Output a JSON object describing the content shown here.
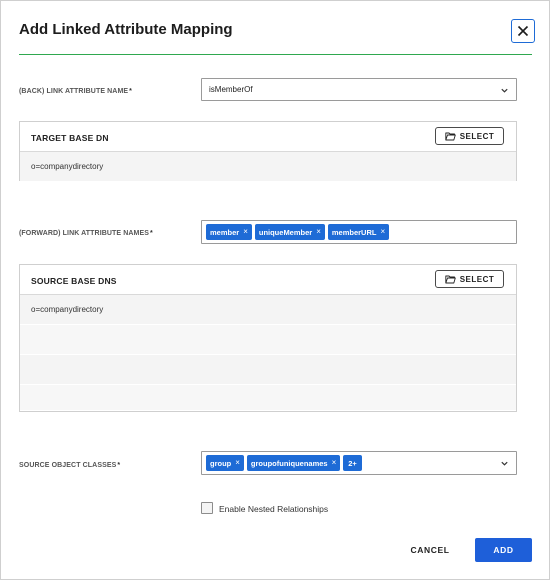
{
  "dialog": {
    "title": "Add Linked Attribute Mapping",
    "close_icon": "close-icon",
    "accent_color": "#2fa84f",
    "primary_color": "#1e5fd9"
  },
  "back_link": {
    "label": "(BACK) LINK ATTRIBUTE NAME",
    "required_mark": "*",
    "value": "isMemberOf",
    "icon": "chevron-down-icon"
  },
  "target_base_dn": {
    "title": "TARGET BASE DN",
    "select_label": "SELECT",
    "select_icon": "folder-open-icon",
    "rows": [
      "o=companydirectory"
    ]
  },
  "forward_links": {
    "label": "(FORWARD) LINK ATTRIBUTE NAMES",
    "required_mark": "*",
    "chips": [
      "member",
      "uniqueMember",
      "memberURL"
    ],
    "chip_remove": "×"
  },
  "source_base_dns": {
    "title": "SOURCE BASE DNS",
    "select_label": "SELECT",
    "select_icon": "folder-open-icon",
    "rows": [
      "o=companydirectory",
      "",
      "",
      "",
      ""
    ]
  },
  "object_classes": {
    "label": "SOURCE OBJECT CLASSES",
    "required_mark": "*",
    "chips": [
      "group",
      "groupofuniquenames"
    ],
    "more": "2+",
    "chip_remove": "×",
    "icon": "chevron-down-icon"
  },
  "nested": {
    "label": "Enable Nested Relationships",
    "checked": false
  },
  "footer": {
    "cancel_label": "CANCEL",
    "add_label": "ADD"
  }
}
